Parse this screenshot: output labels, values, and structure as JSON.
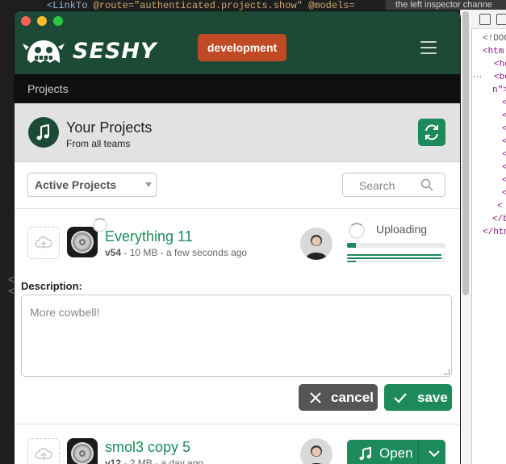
{
  "editor": {
    "line1_tag": "<LinkTo",
    "line1_rest": " @route=\"authenticated.projects.show\" @models=",
    "brackets": [
      "<",
      "<"
    ]
  },
  "devtools": {
    "tooltip": "the left inspector channe",
    "tree": [
      "<!DOC",
      "<htm",
      "<he",
      "<bo",
      "n\">",
      "<",
      "<",
      "<",
      "<",
      "<",
      "<",
      "<",
      "<",
      "<",
      "</b",
      "</htm"
    ]
  },
  "app": {
    "brand": "SESHY",
    "environment": "development",
    "breadcrumb": "Projects",
    "page_title": "Your Projects",
    "page_subtitle": "From all teams",
    "filter_selected": "Active Projects",
    "search_placeholder": "Search",
    "colors": {
      "primary": "#1c4a36",
      "accent": "#1c8a5a",
      "env": "#c04a25"
    }
  },
  "projects": [
    {
      "name": "Everything 11",
      "version": "v54",
      "meta": " - 10 MB - a few seconds ago",
      "status": "Uploading",
      "upload_progress": 0.09,
      "description_label": "Description:",
      "description_placeholder": "More cowbell!",
      "cancel_label": "cancel",
      "save_label": "save"
    },
    {
      "name": "smol3 copy 5",
      "version": "v12",
      "meta": " - 2 MB - a day ago",
      "open_label": "Open"
    }
  ]
}
